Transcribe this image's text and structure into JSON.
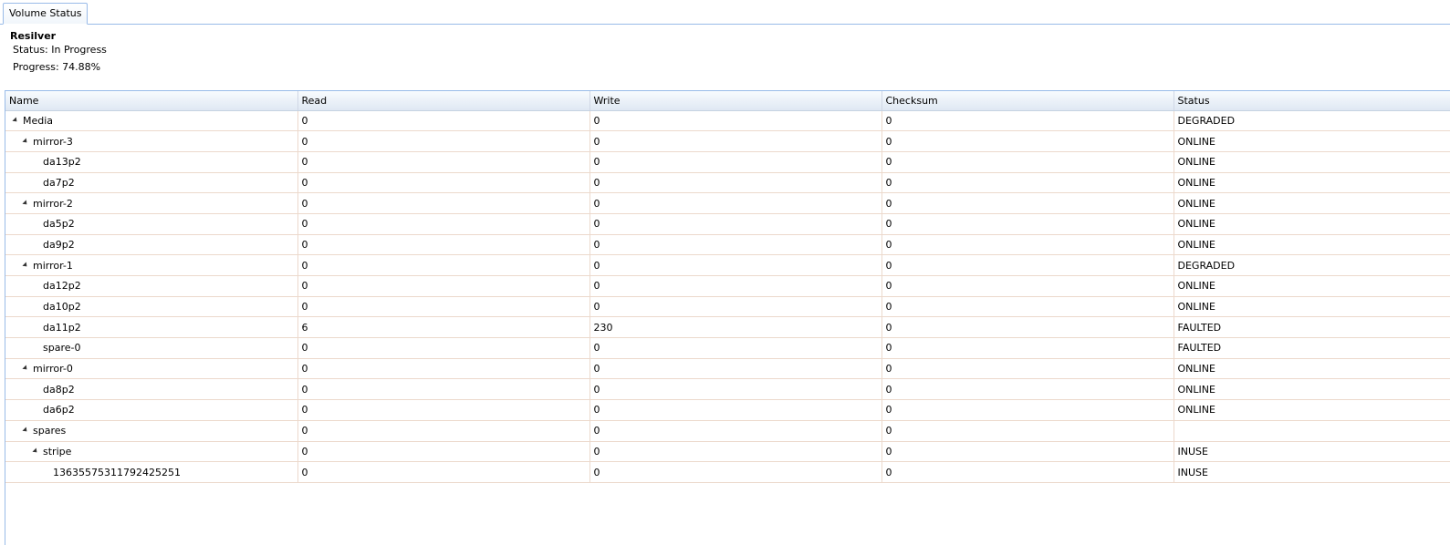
{
  "tabs": [
    {
      "label": "Volume Status"
    }
  ],
  "resilver": {
    "title": "Resilver",
    "status": "Status: In Progress",
    "progress": "Progress: 74.88%"
  },
  "columns": [
    "Name",
    "Read",
    "Write",
    "Checksum",
    "Status"
  ],
  "rows": [
    {
      "level": 0,
      "expandable": true,
      "name": "Media",
      "read": "0",
      "write": "0",
      "checksum": "0",
      "status": "DEGRADED"
    },
    {
      "level": 1,
      "expandable": true,
      "name": "mirror-3",
      "read": "0",
      "write": "0",
      "checksum": "0",
      "status": "ONLINE"
    },
    {
      "level": 2,
      "expandable": false,
      "name": "da13p2",
      "read": "0",
      "write": "0",
      "checksum": "0",
      "status": "ONLINE"
    },
    {
      "level": 2,
      "expandable": false,
      "name": "da7p2",
      "read": "0",
      "write": "0",
      "checksum": "0",
      "status": "ONLINE"
    },
    {
      "level": 1,
      "expandable": true,
      "name": "mirror-2",
      "read": "0",
      "write": "0",
      "checksum": "0",
      "status": "ONLINE"
    },
    {
      "level": 2,
      "expandable": false,
      "name": "da5p2",
      "read": "0",
      "write": "0",
      "checksum": "0",
      "status": "ONLINE"
    },
    {
      "level": 2,
      "expandable": false,
      "name": "da9p2",
      "read": "0",
      "write": "0",
      "checksum": "0",
      "status": "ONLINE"
    },
    {
      "level": 1,
      "expandable": true,
      "name": "mirror-1",
      "read": "0",
      "write": "0",
      "checksum": "0",
      "status": "DEGRADED"
    },
    {
      "level": 2,
      "expandable": false,
      "name": "da12p2",
      "read": "0",
      "write": "0",
      "checksum": "0",
      "status": "ONLINE"
    },
    {
      "level": 2,
      "expandable": false,
      "name": "da10p2",
      "read": "0",
      "write": "0",
      "checksum": "0",
      "status": "ONLINE"
    },
    {
      "level": 2,
      "expandable": false,
      "name": "da11p2",
      "read": "6",
      "write": "230",
      "checksum": "0",
      "status": "FAULTED"
    },
    {
      "level": 2,
      "expandable": false,
      "name": "spare-0",
      "read": "0",
      "write": "0",
      "checksum": "0",
      "status": "FAULTED"
    },
    {
      "level": 1,
      "expandable": true,
      "name": "mirror-0",
      "read": "0",
      "write": "0",
      "checksum": "0",
      "status": "ONLINE"
    },
    {
      "level": 2,
      "expandable": false,
      "name": "da8p2",
      "read": "0",
      "write": "0",
      "checksum": "0",
      "status": "ONLINE"
    },
    {
      "level": 2,
      "expandable": false,
      "name": "da6p2",
      "read": "0",
      "write": "0",
      "checksum": "0",
      "status": "ONLINE"
    },
    {
      "level": 1,
      "expandable": true,
      "name": "spares",
      "read": "0",
      "write": "0",
      "checksum": "0",
      "status": ""
    },
    {
      "level": 2,
      "expandable": true,
      "name": "stripe",
      "read": "0",
      "write": "0",
      "checksum": "0",
      "status": "INUSE"
    },
    {
      "level": 3,
      "expandable": false,
      "name": "13635575311792425251",
      "read": "0",
      "write": "0",
      "checksum": "0",
      "status": "INUSE"
    }
  ]
}
